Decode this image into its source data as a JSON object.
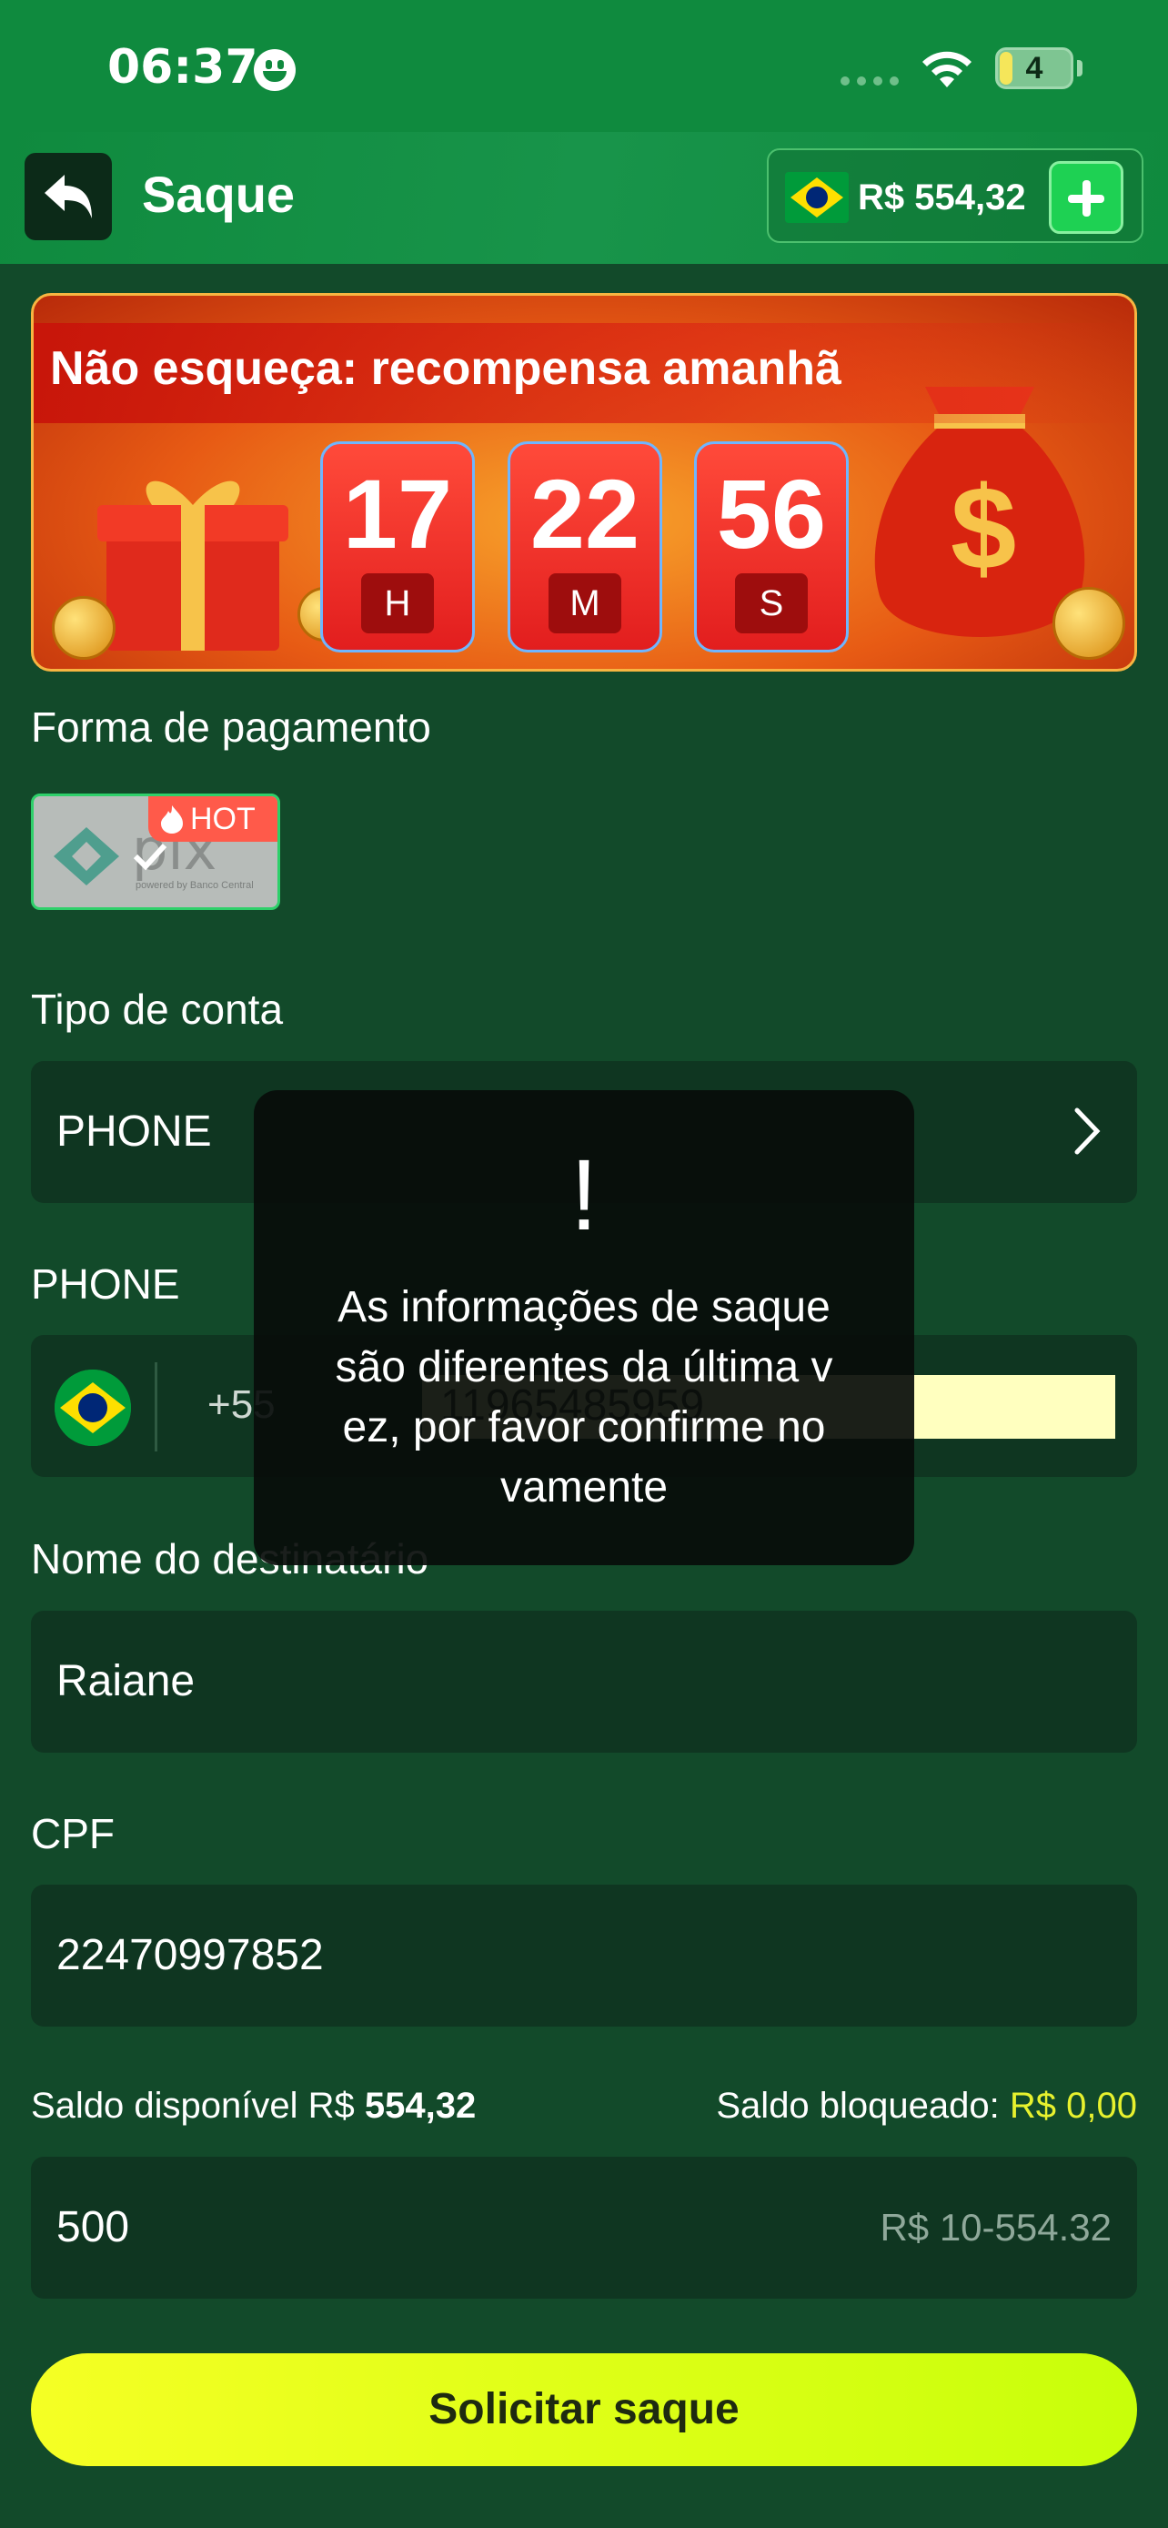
{
  "status_bar": {
    "time": "06:37",
    "battery": "4",
    "emoji": "smiley-face-icon"
  },
  "header": {
    "title": "Saque",
    "balance": "R$ 554,32"
  },
  "banner": {
    "title": "Não esqueça: recompensa amanhã",
    "timer": [
      {
        "value": "17",
        "unit": "H"
      },
      {
        "value": "22",
        "unit": "M"
      },
      {
        "value": "56",
        "unit": "S"
      }
    ]
  },
  "payment": {
    "label": "Forma de pagamento",
    "method": "pix",
    "method_sub": "powered by Banco Central",
    "badge": "HOT"
  },
  "account_type": {
    "label": "Tipo de conta",
    "value": "PHONE"
  },
  "phone": {
    "label": "PHONE",
    "prefix": "+55",
    "value": "11965485959"
  },
  "recipient": {
    "label": "Nome do destinatário",
    "value": "Raiane"
  },
  "cpf": {
    "label": "CPF",
    "value": "22470997852"
  },
  "balances": {
    "available_label": "Saldo disponível R$",
    "available_value": "554,32",
    "blocked_label": "Saldo bloqueado:",
    "blocked_value": "R$ 0,00"
  },
  "amount": {
    "value": "500",
    "range_hint": "R$ 10-554.32"
  },
  "submit": {
    "label": "Solicitar saque"
  },
  "toast": {
    "icon": "!",
    "lines": [
      "As informações de saque",
      "são diferentes da última v",
      "ez, por favor confirme no",
      "vamente"
    ]
  },
  "colors": {
    "primary_green": "#0f8a3e",
    "background": "#124a2a",
    "accent_yellow": "#e7f12e",
    "hot_red": "#ff5a4a"
  }
}
